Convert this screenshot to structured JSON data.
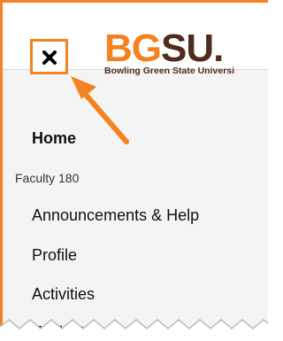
{
  "header": {
    "close_icon": "close-icon",
    "logo": {
      "mark_bg": "BG",
      "mark_su": "SU",
      "mark_dot": ".",
      "subtitle": "Bowling Green State Universi"
    }
  },
  "menu": {
    "home_label": "Home",
    "section_label": "Faculty 180",
    "items": [
      {
        "label": "Announcements & Help"
      },
      {
        "label": "Profile"
      },
      {
        "label": "Activities"
      },
      {
        "label": "Evaluations"
      }
    ]
  },
  "colors": {
    "accent": "#f58220",
    "brand_brown": "#4f2c1d",
    "sidebar_bg": "#f4f4f4"
  }
}
